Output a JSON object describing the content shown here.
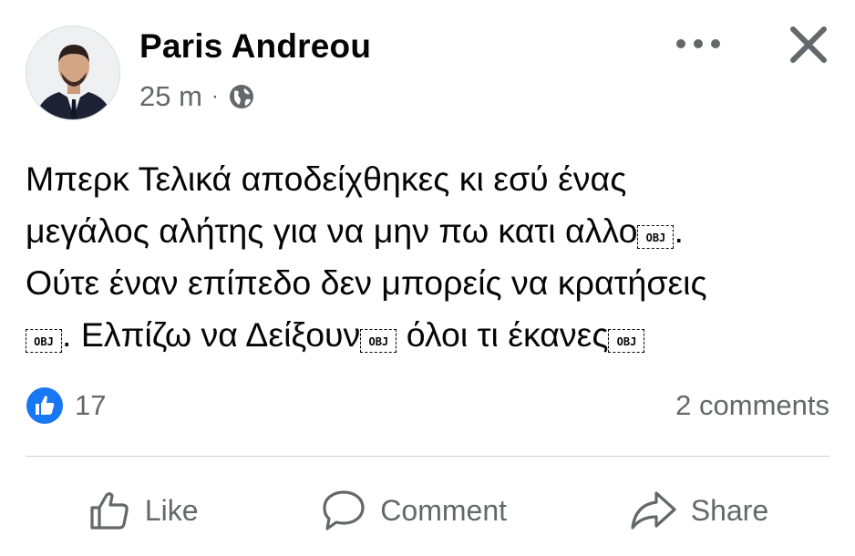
{
  "post": {
    "author": "Paris Andreou",
    "time": "25 m",
    "separator": "·",
    "privacy_icon": "globe-icon",
    "text_lines": [
      [
        "Μπερκ Τελικά αποδείχθηκες κι εσύ ένας"
      ],
      [
        "μεγάλος αλήτης για να μην πω κατι αλλο",
        "OBJ",
        "."
      ],
      [
        "Ούτε έναν επίπεδο δεν μπορείς να κρατήσεις"
      ],
      [
        "OBJ",
        ". Ελπίζω να Δείξουν",
        "OBJ",
        " όλοι τι έκανες",
        "OBJ"
      ]
    ]
  },
  "reactions": {
    "count": "17",
    "icon": "like-reaction-icon",
    "color": "#1877f2"
  },
  "comments": {
    "label": "2 comments"
  },
  "actions": {
    "like": {
      "label": "Like",
      "icon": "thumbs-up-icon"
    },
    "comment": {
      "label": "Comment",
      "icon": "speech-bubble-icon"
    },
    "share": {
      "label": "Share",
      "icon": "share-arrow-icon"
    }
  }
}
